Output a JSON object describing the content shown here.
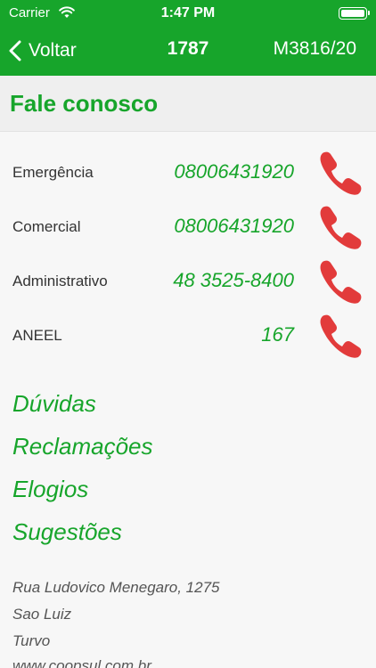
{
  "status_bar": {
    "carrier": "Carrier",
    "time": "1:47 PM"
  },
  "nav": {
    "back_label": "Voltar",
    "title": "1787",
    "reference": "M3816/20"
  },
  "page": {
    "title": "Fale conosco"
  },
  "contacts": [
    {
      "label": "Emergência",
      "number": "08006431920"
    },
    {
      "label": "Comercial",
      "number": "08006431920"
    },
    {
      "label": "Administrativo",
      "number": "48 3525-8400"
    },
    {
      "label": "ANEEL",
      "number": "167"
    }
  ],
  "links": [
    "Dúvidas",
    "Reclamações",
    "Elogios",
    "Sugestões"
  ],
  "address": {
    "street": "Rua Ludovico Menegaro, 1275",
    "district": "Sao Luiz",
    "city": "Turvo",
    "website": "www.coopsul.com.br"
  },
  "colors": {
    "brand_green": "#17a52b",
    "phone_red": "#e23b3b"
  },
  "icons": {
    "call": "phone-handset-icon",
    "back": "chevron-left-icon",
    "wifi": "wifi-icon",
    "battery": "battery-icon"
  }
}
